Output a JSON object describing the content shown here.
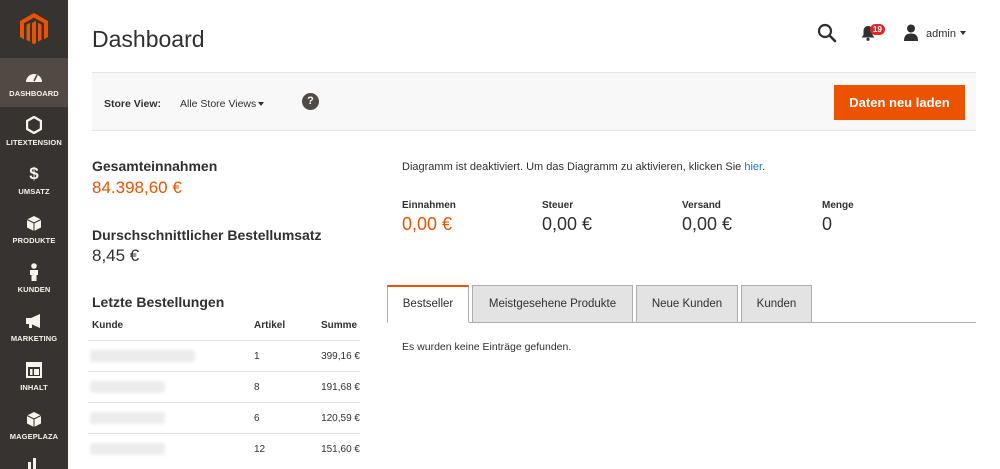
{
  "sidebar": {
    "items": [
      {
        "label": "DASHBOARD",
        "icon": "dashboard-gauge-icon"
      },
      {
        "label": "LITEXTENSION",
        "icon": "hexagon-icon"
      },
      {
        "label": "UMSATZ",
        "icon": "dollar-icon"
      },
      {
        "label": "PRODUKTE",
        "icon": "box-icon"
      },
      {
        "label": "KUNDEN",
        "icon": "person-icon"
      },
      {
        "label": "MARKETING",
        "icon": "megaphone-icon"
      },
      {
        "label": "INHALT",
        "icon": "layout-icon"
      },
      {
        "label": "MAGEPLAZA",
        "icon": "cube-icon"
      }
    ]
  },
  "header": {
    "title": "Dashboard",
    "notification_count": "19",
    "user_name": "admin"
  },
  "store_bar": {
    "label": "Store View:",
    "selected": "Alle Store Views",
    "help": "?",
    "reload_label": "Daten neu laden"
  },
  "stats": {
    "revenue_label": "Gesamteinnahmen",
    "revenue_value": "84.398,60 €",
    "avg_label": "Durschschnittlicher Bestellumsatz",
    "avg_value": "8,45 €"
  },
  "orders": {
    "title": "Letzte Bestellungen",
    "columns": {
      "customer": "Kunde",
      "items": "Artikel",
      "total": "Summe"
    },
    "rows": [
      {
        "items": "1",
        "total": "399,16 €"
      },
      {
        "items": "8",
        "total": "191,68 €"
      },
      {
        "items": "6",
        "total": "120,59 €"
      },
      {
        "items": "12",
        "total": "151,60 €"
      }
    ]
  },
  "chart": {
    "message": "Diagramm ist deaktiviert. Um das Diagramm zu aktivieren, klicken Sie ",
    "link": "hier",
    "period": "."
  },
  "metrics": [
    {
      "label": "Einnahmen",
      "value": "0,00 €"
    },
    {
      "label": "Steuer",
      "value": "0,00 €"
    },
    {
      "label": "Versand",
      "value": "0,00 €"
    },
    {
      "label": "Menge",
      "value": "0"
    }
  ],
  "tabs": [
    {
      "label": "Bestseller"
    },
    {
      "label": "Meistgesehene Produkte"
    },
    {
      "label": "Neue Kunden"
    },
    {
      "label": "Kunden"
    }
  ],
  "tab_content": {
    "empty": "Es wurden keine Einträge gefunden."
  },
  "colors": {
    "accent": "#eb5202",
    "sidebar": "#373330",
    "link": "#1979c3"
  }
}
